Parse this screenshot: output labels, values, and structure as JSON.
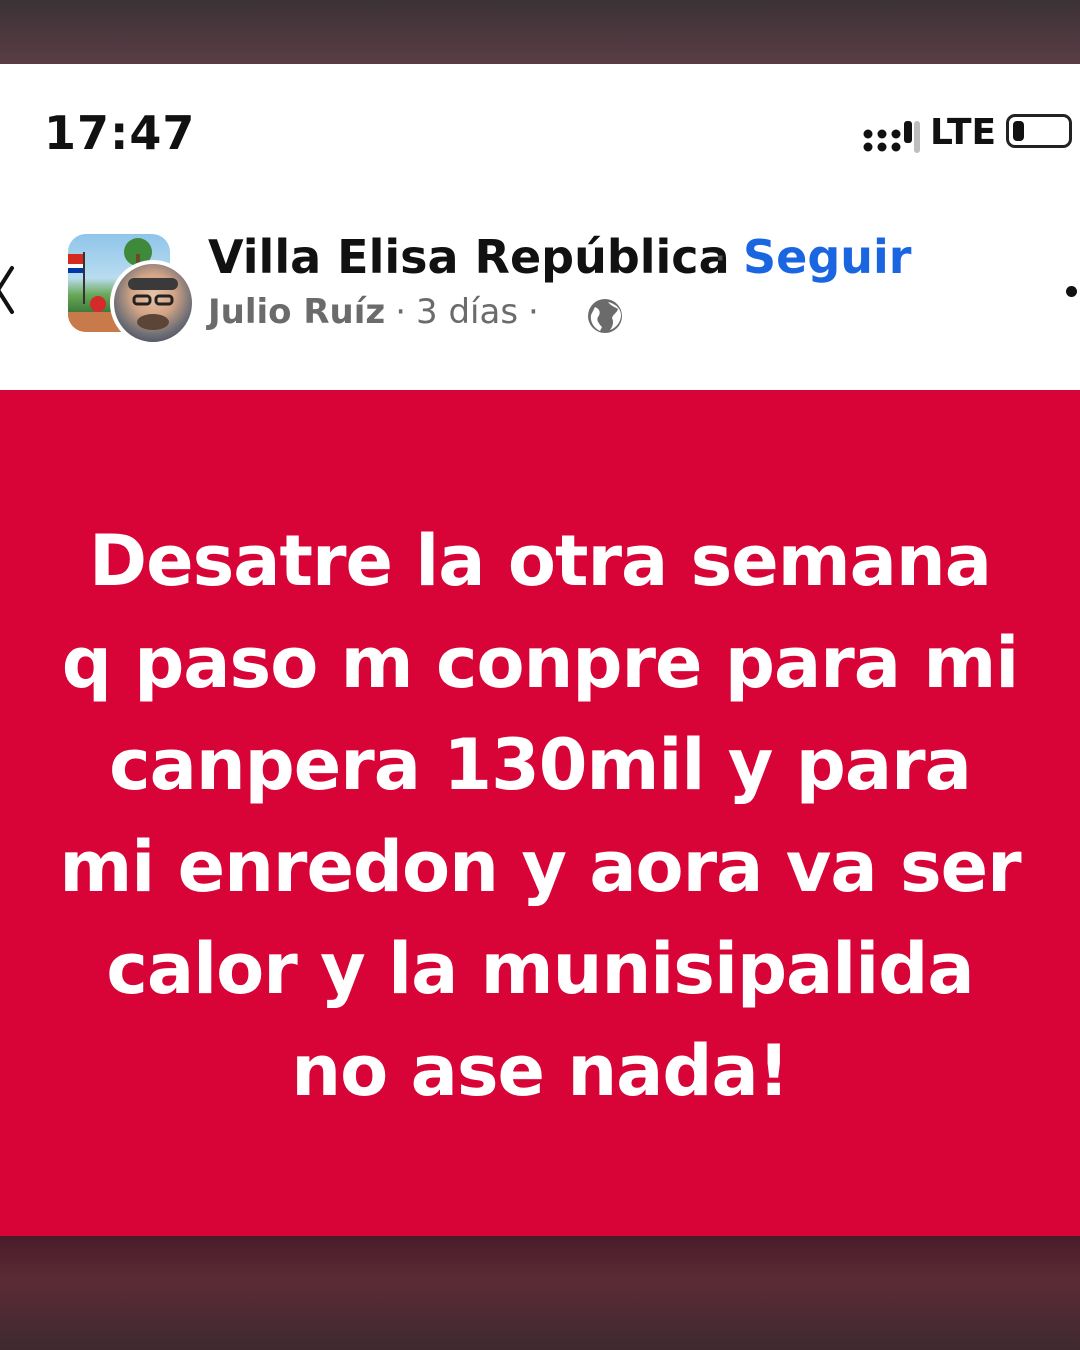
{
  "status_bar": {
    "time": "17:47",
    "network": "LTE",
    "signal_icon": "signal-bars-icon",
    "battery_icon": "battery-icon",
    "battery_level": 0.2
  },
  "post": {
    "page_name": "Villa Elisa República",
    "separator": "·",
    "follow_label": "Seguir",
    "author": "Julio Ruíz",
    "time_ago": "3 días",
    "privacy_icon": "globe-icon",
    "back_icon": "back-chevron-icon",
    "more_icon": "more-options-icon",
    "body_color": "#d80336",
    "body_text": "Desatre la otra semana\nq paso m conpre para mi\ncanpera 130mil y para\nmi enredon y aora va ser\ncalor y la munisipalida\nno ase nada!"
  },
  "colors": {
    "accent": "#1a66e0",
    "post_background": "#d80336"
  }
}
